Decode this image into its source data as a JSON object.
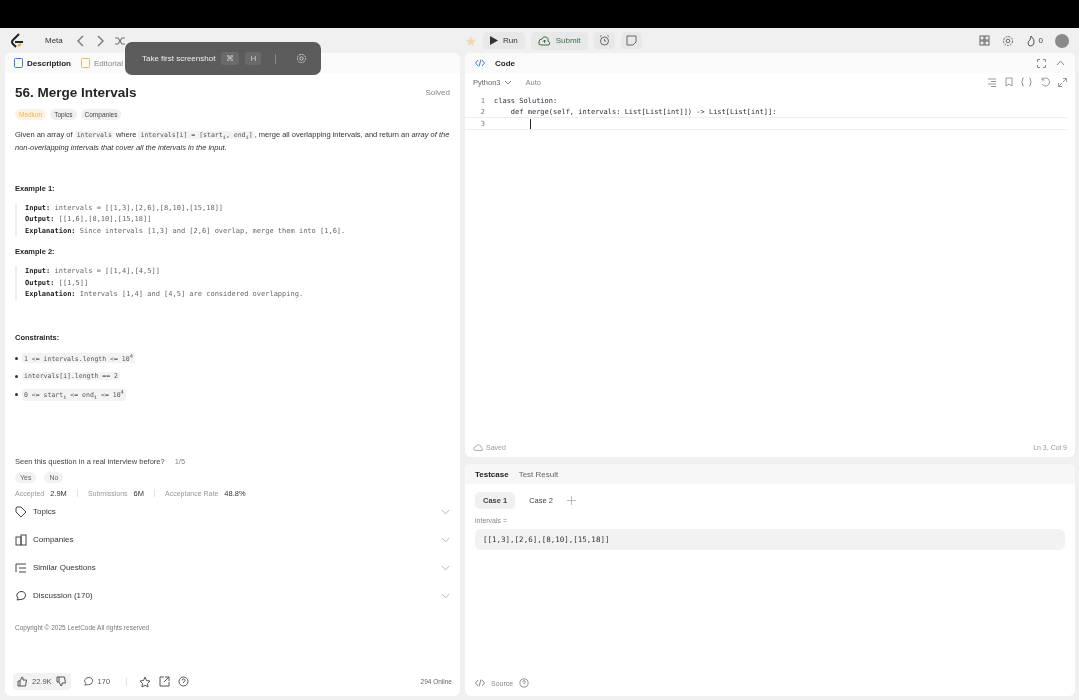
{
  "nav": {
    "brand": "Meta"
  },
  "overlay": {
    "label": "Take first screenshot",
    "keys": [
      "⌘",
      "H"
    ]
  },
  "toolbar": {
    "run": "Run",
    "submit": "Submit",
    "coins": "0"
  },
  "left": {
    "tabs": [
      {
        "label": "Description",
        "selected": true
      },
      {
        "label": "Editorial",
        "selected": false
      }
    ],
    "title": "56. Merge Intervals",
    "status": "Solved",
    "difficulty": "Medium",
    "tags": [
      "Topics",
      "Companies"
    ],
    "description": [
      {
        "kind": "text",
        "text": "Given an array of "
      },
      {
        "kind": "code",
        "text": "intervals"
      },
      {
        "kind": "text",
        "text": " where "
      },
      {
        "kind": "code",
        "text": "intervals[i] = [start$_{i}$, end$_{i}$]"
      },
      {
        "kind": "text",
        "text": ", merge all overlapping intervals, and return an *array of the non-overlapping intervals that cover all the intervals in the input.*"
      }
    ],
    "examples": [
      {
        "title": "Example 1:",
        "lines": [
          "**Input:** intervals = [[1,3],[2,6],[8,10],[15,18]]",
          "**Output:** [[1,6],[8,10],[15,18]]",
          "**Explanation:** Since intervals [1,3] and [2,6] overlap, merge them into [1,6]."
        ]
      },
      {
        "title": "Example 2:",
        "lines": [
          "**Input:** intervals = [[1,4],[4,5]]",
          "**Output:** [[1,5]]",
          "**Explanation:** Intervals [1,4] and [4,5] are considered overlapping."
        ]
      }
    ],
    "constraints_title": "Constraints:",
    "constraints": [
      "1 <= intervals.length <= 10$^{4}$",
      "intervals[i].length == 2",
      "0 <= start$_{i}$ <= end$_{i}$ <= 10$^{4}$"
    ],
    "interview": {
      "question": "Seen this question in a real interview before?",
      "count": "1/5",
      "answers": [
        "Yes",
        "No"
      ]
    },
    "stats": [
      {
        "label": "Accepted",
        "value": "2.9M"
      },
      {
        "label": "Submissions",
        "value": "6M"
      },
      {
        "label": "Acceptance Rate",
        "value": "48.8%"
      }
    ],
    "sections": [
      {
        "kind": "tag",
        "label": "Topics",
        "expanded": false
      },
      {
        "kind": "building",
        "label": "Companies",
        "expanded": false
      },
      {
        "kind": "list",
        "label": "Similar Questions",
        "expanded": false
      },
      {
        "kind": "chat",
        "label": "Discussion (170)",
        "expanded": false
      }
    ],
    "copyright": "Copyright © 2025 LeetCode All rights reserved",
    "footer": {
      "likes": "22.9K",
      "comments": "170",
      "online": "294 Online"
    }
  },
  "code": {
    "title": "Code",
    "language": "Python3",
    "mode": "Auto",
    "lines": [
      {
        "number": "1",
        "text": "class Solution:"
      },
      {
        "number": "2",
        "text": "    def merge(self, intervals: List[List[int]]) -> List[List[int]]:"
      },
      {
        "number": "3",
        "cursor": true
      }
    ],
    "saved": "Saved",
    "position": "Ln 3, Col 9"
  },
  "testcase": {
    "tabs": [
      {
        "label": "Testcase",
        "selected": true
      },
      {
        "label": "Test Result",
        "selected": false
      }
    ],
    "cases": [
      {
        "label": "Case 1",
        "selected": true
      },
      {
        "label": "Case 2",
        "selected": false
      }
    ],
    "param": "intervals =",
    "value": "[[1,3],[2,6],[8,10],[15,18]]",
    "source": "Source"
  }
}
